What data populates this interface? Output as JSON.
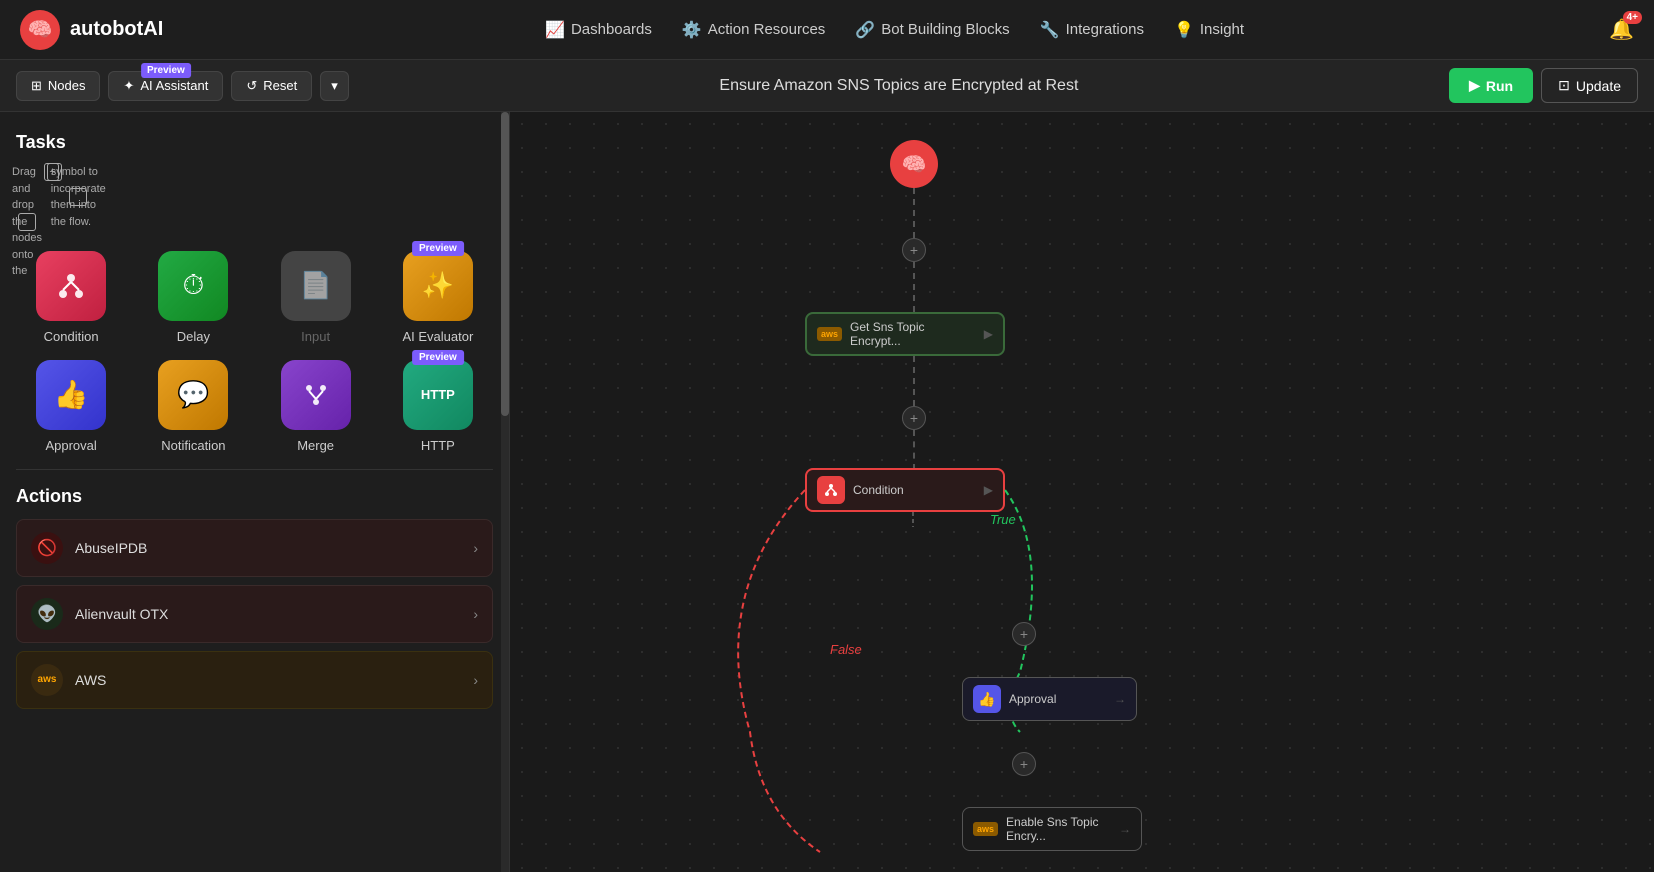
{
  "app": {
    "logo_text": "autobotAI",
    "notification_count": "4+"
  },
  "navbar": {
    "links": [
      {
        "id": "dashboards",
        "icon": "📈",
        "label": "Dashboards"
      },
      {
        "id": "action-resources",
        "icon": "⚙️",
        "label": "Action Resources"
      },
      {
        "id": "bot-building-blocks",
        "icon": "🔗",
        "label": "Bot Building Blocks"
      },
      {
        "id": "integrations",
        "icon": "🔧",
        "label": "Integrations"
      },
      {
        "id": "insight",
        "icon": "💡",
        "label": "Insight"
      }
    ]
  },
  "toolbar": {
    "nodes_label": "Nodes",
    "ai_assistant_label": "AI Assistant",
    "preview_label": "Preview",
    "reset_label": "Reset",
    "flow_title": "Ensure Amazon SNS Topics are Encrypted at Rest",
    "run_label": "Run",
    "update_label": "Update"
  },
  "sidebar": {
    "tasks_title": "Tasks",
    "tasks_desc_part1": "Drag and drop the nodes onto the",
    "tasks_desc_symbol": "+",
    "tasks_desc_part2": "symbol to incorporate them into the flow.",
    "preview_badge": "Preview",
    "nodes": [
      {
        "id": "condition",
        "label": "Condition",
        "icon": "⑂",
        "bg": "#e84060",
        "disabled": false
      },
      {
        "id": "delay",
        "label": "Delay",
        "icon": "⏱",
        "bg": "#22aa44",
        "disabled": false
      },
      {
        "id": "input",
        "label": "Input",
        "icon": "📄",
        "bg": "#555",
        "disabled": true
      },
      {
        "id": "ai-evaluator",
        "label": "AI Evaluator",
        "icon": "✨",
        "bg": "#e8a020",
        "disabled": false,
        "preview": true
      }
    ],
    "nodes2": [
      {
        "id": "approval",
        "label": "Approval",
        "icon": "👍",
        "bg": "#5555e8",
        "disabled": false
      },
      {
        "id": "notification",
        "label": "Notification",
        "icon": "💬",
        "bg": "#e8a020",
        "disabled": false
      },
      {
        "id": "merge",
        "label": "Merge",
        "icon": "⑃",
        "bg": "#7a3aaa",
        "disabled": false
      },
      {
        "id": "http",
        "label": "HTTP",
        "icon": "HTTP",
        "bg": "#22aa80",
        "disabled": false,
        "preview": true
      }
    ],
    "actions_title": "Actions",
    "action_items": [
      {
        "id": "abuseipdb",
        "label": "AbuseIPDB",
        "icon": "🚫",
        "icon_bg": "#3a1010"
      },
      {
        "id": "alienvault",
        "label": "Alienvault OTX",
        "icon": "👽",
        "icon_bg": "#1a2a1a"
      },
      {
        "id": "aws",
        "label": "AWS",
        "icon": "aws",
        "icon_bg": "#3a2a10"
      }
    ]
  },
  "canvas": {
    "flow_title": "Ensure Amazon SNS Topics are Encrypted at Rest",
    "nodes": [
      {
        "id": "start",
        "type": "start"
      },
      {
        "id": "get-sns",
        "type": "aws",
        "label": "Get Sns Topic Encrypt..."
      },
      {
        "id": "condition",
        "type": "condition",
        "label": "Condition"
      },
      {
        "id": "approval",
        "type": "approval",
        "label": "Approval"
      },
      {
        "id": "enable-sns",
        "type": "aws",
        "label": "Enable Sns Topic Encry..."
      }
    ],
    "true_label": "True",
    "false_label": "False"
  }
}
